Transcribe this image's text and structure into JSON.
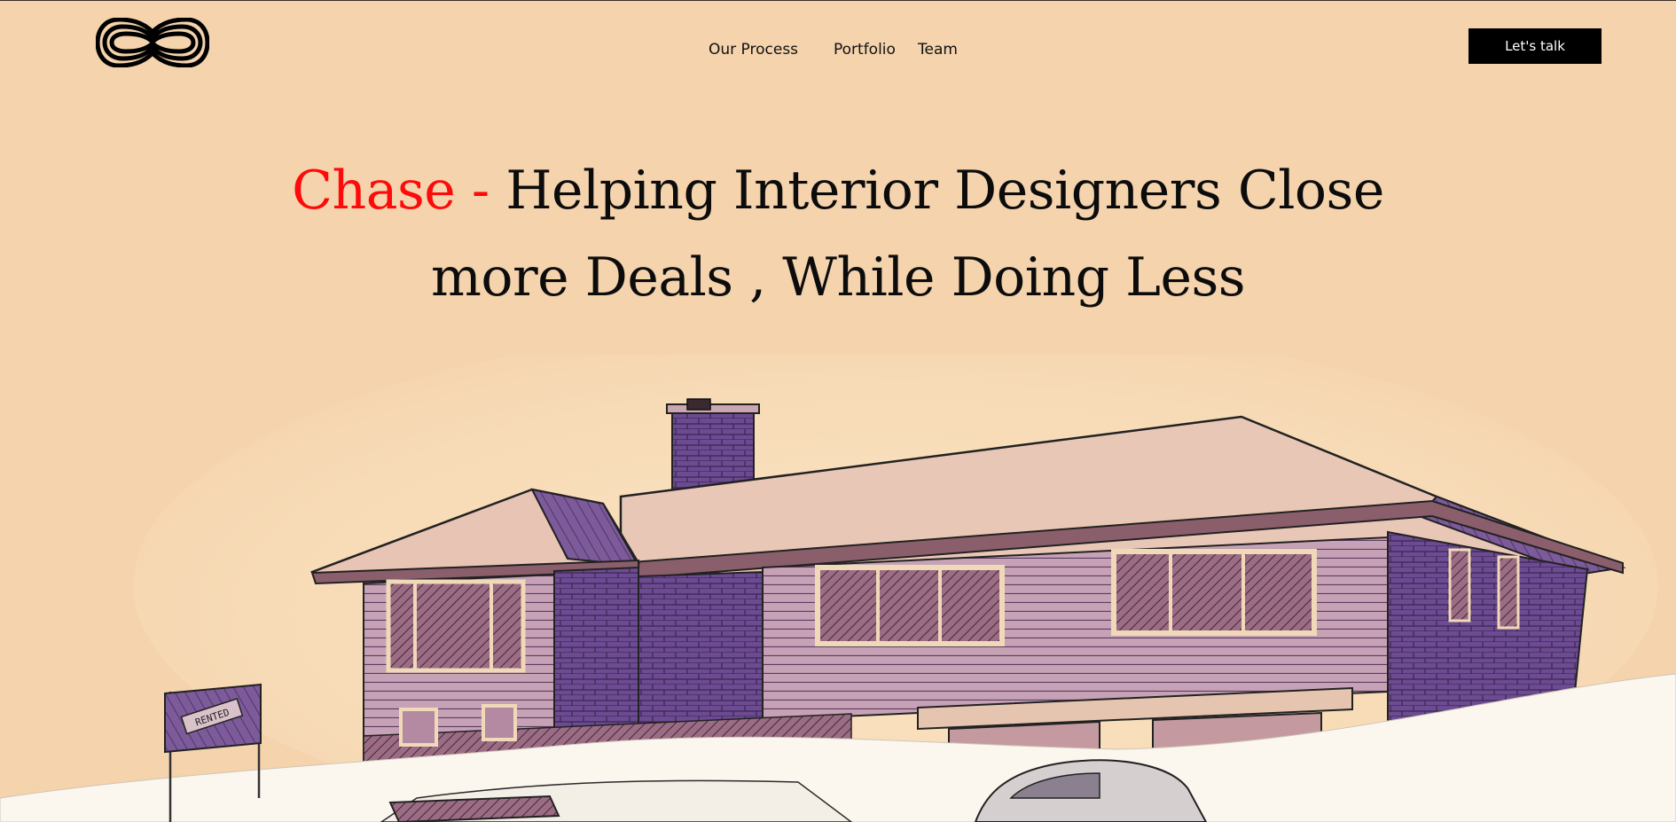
{
  "nav": {
    "logo_name": "brand-logo",
    "links": [
      {
        "label": "Our Process"
      },
      {
        "label": "Portfolio"
      },
      {
        "label": "Team"
      }
    ],
    "cta_label": "Let's talk"
  },
  "hero": {
    "accent": "Chase -",
    "line1_rest": "Helping Interior Designers Close",
    "line2": "more Deals , While Doing Less"
  },
  "illustration": {
    "sign_text": "RENTED"
  },
  "colors": {
    "background": "#f4d3ad",
    "accent": "#ff0a0a",
    "house_purple": "#6b4a8e",
    "button_bg": "#000000"
  }
}
